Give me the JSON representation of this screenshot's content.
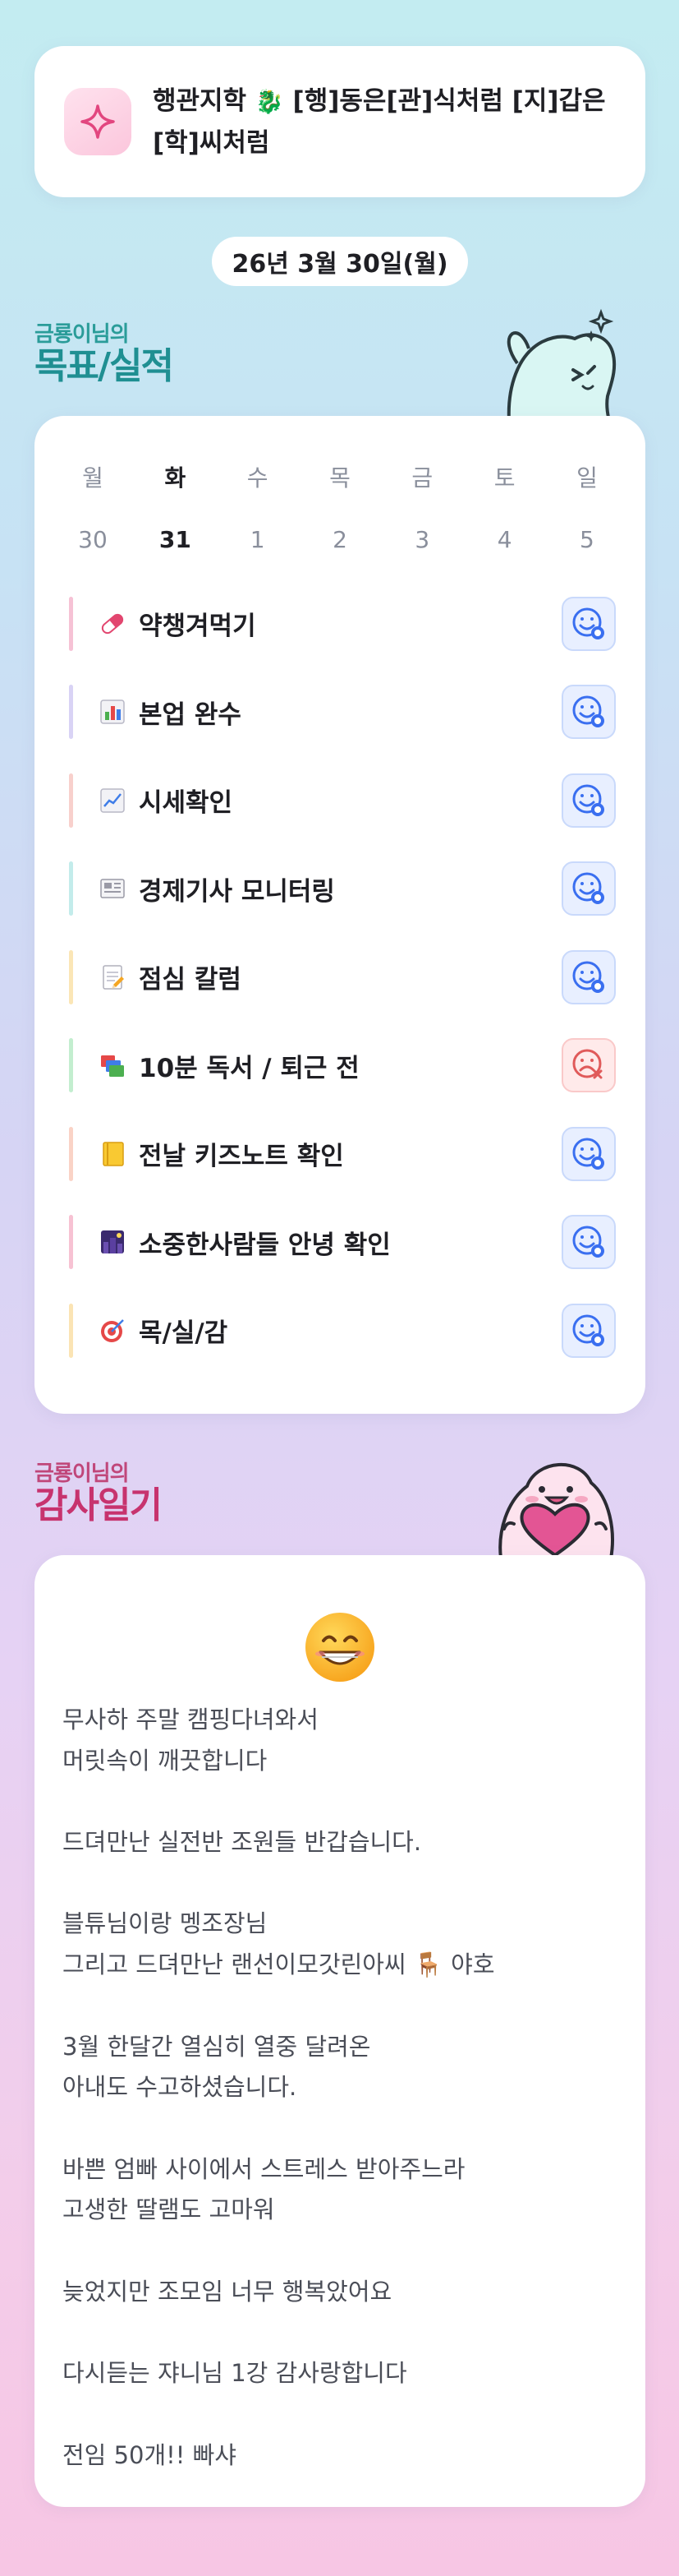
{
  "header": {
    "icon": "sparkle-icon",
    "line1": "행관지학",
    "line1_rest": " [행]동은[관]식처럼 [지]갑은",
    "line2": "[학]씨처럼",
    "emoji": "🐉"
  },
  "date": "26년 3월 30일(월)",
  "goals_section": {
    "sub_title": "금룡이님의",
    "main_title": "목표/실적",
    "days": [
      "월",
      "화",
      "수",
      "목",
      "금",
      "토",
      "일"
    ],
    "dates": [
      "30",
      "31",
      "1",
      "2",
      "3",
      "4",
      "5"
    ],
    "today_index": 1,
    "items": [
      {
        "icon": "pill-icon",
        "label": "약챙겨먹기",
        "bar_color": "#f6c2d5",
        "status": "done"
      },
      {
        "icon": "bar-chart-icon",
        "label": "본업 완수",
        "bar_color": "#d9d3f5",
        "status": "done"
      },
      {
        "icon": "trend-chart-icon",
        "label": "시세확인",
        "bar_color": "#f8d0cc",
        "status": "done"
      },
      {
        "icon": "newspaper-icon",
        "label": "경제기사 모니터링",
        "bar_color": "#c3eceb",
        "status": "done"
      },
      {
        "icon": "memo-icon",
        "label": "점심 칼럼",
        "bar_color": "#fbe6b6",
        "status": "done"
      },
      {
        "icon": "books-icon",
        "label": "10분 독서 / 퇴근 전",
        "bar_color": "#c3eecf",
        "status": "failed"
      },
      {
        "icon": "notebook-icon",
        "label": "전날 키즈노트 확인",
        "bar_color": "#fad3c6",
        "status": "done"
      },
      {
        "icon": "night-city-icon",
        "label": "소중한사람들 안녕 확인",
        "bar_color": "#f7c2d3",
        "status": "done"
      },
      {
        "icon": "target-icon",
        "label": "목/실/감",
        "bar_color": "#fbe4b4",
        "status": "done"
      }
    ]
  },
  "gratitude_section": {
    "sub_title": "금룡이님의",
    "main_title": "감사일기",
    "emoji_icon": "grinning-face-icon",
    "lines": [
      "무사하 주말 캠핑다녀와서",
      "머릿속이 깨끗합니다",
      "",
      "드뎌만난 실전반 조원들 반갑습니다.",
      "",
      "블튜님이랑 멩조장님",
      "그리고 드뎌만난 랜선이모갓린아씨 🪑 야호",
      "",
      "3월 한달간 열심히 열중 달려온",
      "아내도 수고하셨습니다.",
      "",
      "바쁜 엄빠 사이에서 스트레스 받아주느라",
      "고생한 딸램도 고마워",
      "",
      "늦었지만 조모임 너무 행복았어요",
      "",
      "다시듣는 쟈니님 1강 감사랑합니다",
      "",
      "전임 50개!! 빠샤"
    ]
  },
  "colors": {
    "accent_teal": "#1f8f92",
    "accent_pink": "#c7336e",
    "status_done": "#3a6ff0",
    "status_failed": "#e05a5a"
  }
}
